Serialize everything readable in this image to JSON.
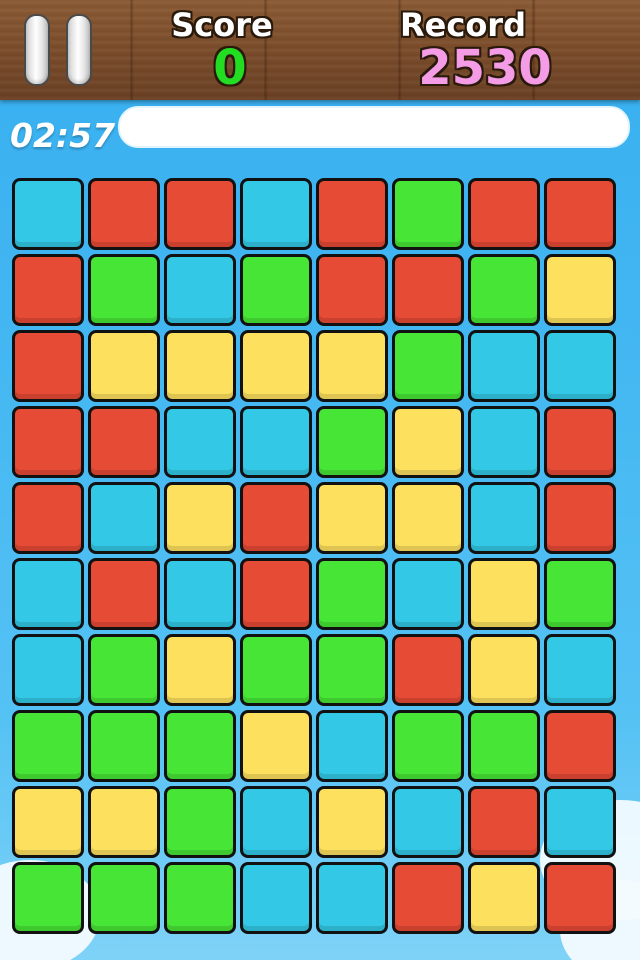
{
  "hud": {
    "score_label": "Score",
    "score_value": "0",
    "record_label": "Record",
    "record_value": "2530",
    "timer": "02:57",
    "time_remaining_fraction": 0.99
  },
  "colors": {
    "score_value": "#22dd22",
    "record_value": "#f59ce6",
    "blue": "#33c9e6",
    "red": "#e54b35",
    "green": "#47e535",
    "yellow": "#fde05e"
  },
  "icons": {
    "pause": "pause-icon"
  },
  "board": {
    "rows": 10,
    "cols": 8,
    "tiles": [
      [
        "blue",
        "red",
        "red",
        "blue",
        "red",
        "green",
        "red",
        "red"
      ],
      [
        "red",
        "green",
        "blue",
        "green",
        "red",
        "red",
        "green",
        "yellow"
      ],
      [
        "red",
        "yellow",
        "yellow",
        "yellow",
        "yellow",
        "green",
        "blue",
        "blue"
      ],
      [
        "red",
        "red",
        "blue",
        "blue",
        "green",
        "yellow",
        "blue",
        "red"
      ],
      [
        "red",
        "blue",
        "yellow",
        "red",
        "yellow",
        "yellow",
        "blue",
        "red"
      ],
      [
        "blue",
        "red",
        "blue",
        "red",
        "green",
        "blue",
        "yellow",
        "green"
      ],
      [
        "blue",
        "green",
        "yellow",
        "green",
        "green",
        "red",
        "yellow",
        "blue"
      ],
      [
        "green",
        "green",
        "green",
        "yellow",
        "blue",
        "green",
        "green",
        "red"
      ],
      [
        "yellow",
        "yellow",
        "green",
        "blue",
        "yellow",
        "blue",
        "red",
        "blue"
      ],
      [
        "green",
        "green",
        "green",
        "blue",
        "blue",
        "red",
        "yellow",
        "red"
      ]
    ]
  }
}
